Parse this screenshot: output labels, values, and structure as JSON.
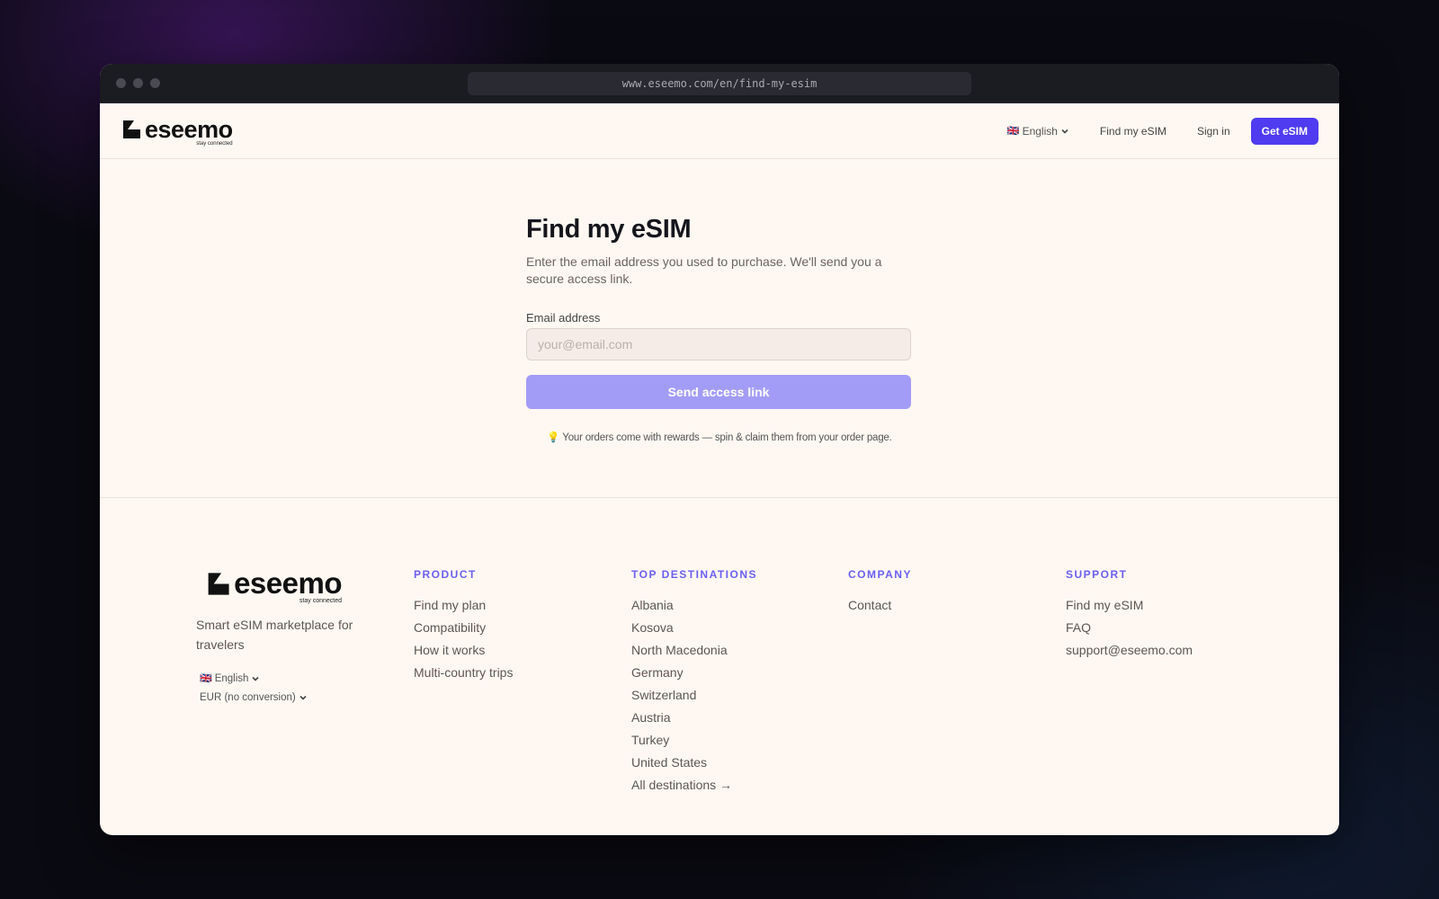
{
  "browser": {
    "url": "www.eseemo.com/en/find-my-esim"
  },
  "brand": {
    "name": "eseemo",
    "tagline": "stay connected"
  },
  "nav": {
    "language": {
      "flag": "🇬🇧",
      "label": "English"
    },
    "find_esim": "Find my eSIM",
    "sign_in": "Sign in",
    "cta": "Get eSIM"
  },
  "main": {
    "title": "Find my eSIM",
    "subtitle": "Enter the email address you used to purchase. We'll send you a secure access link.",
    "email_label": "Email address",
    "email_placeholder": "your@email.com",
    "email_value": "",
    "submit_label": "Send access link",
    "hint_icon": "💡",
    "hint": "Your orders come with rewards — spin & claim them from your order page."
  },
  "footer": {
    "tagline": "Smart eSIM marketplace for travelers",
    "language": {
      "flag": "🇬🇧",
      "label": "English"
    },
    "currency": "EUR (no conversion)",
    "columns": {
      "product": {
        "heading": "PRODUCT",
        "links": [
          "Find my plan",
          "Compatibility",
          "How it works",
          "Multi-country trips"
        ]
      },
      "destinations": {
        "heading": "TOP DESTINATIONS",
        "links": [
          "Albania",
          "Kosova",
          "North Macedonia",
          "Germany",
          "Switzerland",
          "Austria",
          "Turkey",
          "United States",
          "All destinations →"
        ]
      },
      "company": {
        "heading": "COMPANY",
        "links": [
          "Contact"
        ]
      },
      "support": {
        "heading": "SUPPORT",
        "links": [
          "Find my eSIM",
          "FAQ",
          "support@eseemo.com"
        ]
      }
    }
  },
  "colors": {
    "accent": "#4f3cf0",
    "accent_muted": "#a39cf7",
    "heading_accent": "#6b5ff0",
    "page_bg": "#fff8f2"
  }
}
